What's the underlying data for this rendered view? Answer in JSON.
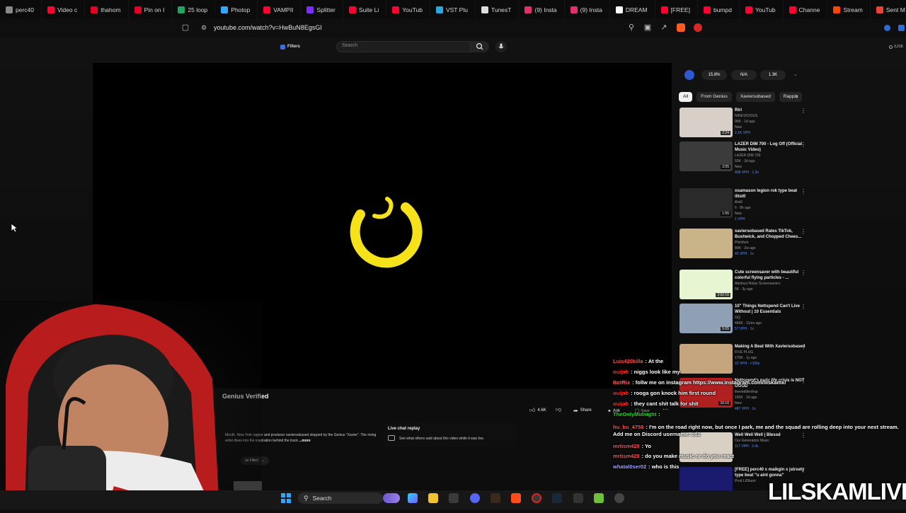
{
  "browser": {
    "tabs": [
      {
        "label": "perc40",
        "color": "#888888"
      },
      {
        "label": "Video c",
        "color": "#ff0033"
      },
      {
        "label": "thahom",
        "color": "#e60023"
      },
      {
        "label": "Pin on I",
        "color": "#e60023"
      },
      {
        "label": "25 loop",
        "color": "#1fa463"
      },
      {
        "label": "Photop",
        "color": "#31a8ff"
      },
      {
        "label": "VAMPII",
        "color": "#ff0033"
      },
      {
        "label": "Splitter",
        "color": "#7b2cff"
      },
      {
        "label": "Suite Li",
        "color": "#ff0033"
      },
      {
        "label": "YouTub",
        "color": "#ff0033"
      },
      {
        "label": "VST Plu",
        "color": "#2aa9e0"
      },
      {
        "label": "TunesT",
        "color": "#dddddd"
      },
      {
        "label": "(9) Insta",
        "color": "#e1306c"
      },
      {
        "label": "(9) Insta",
        "color": "#e1306c"
      },
      {
        "label": "DREAM",
        "color": "#ffffff"
      },
      {
        "label": "[FREE]",
        "color": "#ff0033"
      },
      {
        "label": "bumpd",
        "color": "#ff0033"
      },
      {
        "label": "YouTub",
        "color": "#ff0033"
      },
      {
        "label": "Channe",
        "color": "#ff0033"
      },
      {
        "label": "Stream",
        "color": "#ff4500"
      },
      {
        "label": "Sent M",
        "color": "#ea4335"
      }
    ],
    "url": "youtube.com/watch?v=HwBuN8EgsGI",
    "views_badge": "3,218"
  },
  "youtube": {
    "filters_label": "Filters",
    "search_placeholder": "Search",
    "channel_name": "Genius Verified",
    "description": "Month, New York rapper and producer xaviersobased stopped by the Genius \"Xavier\". The rising artist dives into the inspiration behind the track",
    "more_label": "...more",
    "likes": "4.6K",
    "share_label": "Share",
    "ask_label": "Ask",
    "save_label": "Save",
    "pill_label": "se Filter)",
    "live_chat": {
      "title": "Live chat replay",
      "subtitle": "See what others said about this video while it was live."
    },
    "stats": [
      "15.8%",
      "N/A",
      "1.3K"
    ],
    "chips": [
      "All",
      "From Genius",
      "Xaviersobased",
      "Rappin"
    ],
    "recommendations": [
      {
        "title": "Riri",
        "channel": "NINEVICIOUS",
        "stats": "95K · 1d ago",
        "tag": "New",
        "extra": "2.1K VPH",
        "duration": "2:24",
        "thumb": "#d9cfc9"
      },
      {
        "title": "LAZER DIM 700 - Log Off (Official Music Video)",
        "channel": "LAZER DIM 700",
        "stats": "55K · 3d ago",
        "tag": "New",
        "extra": "408 VPH · 1.3x",
        "duration": "2:05",
        "thumb": "#3b3b3b"
      },
      {
        "title": "osamason legion rok type beat illist0",
        "channel": "illist0",
        "stats": "6 · 8h ago",
        "tag": "New",
        "extra": "1 VPH",
        "duration": "1:55",
        "thumb": "#2a2a2a"
      },
      {
        "title": "xaviersobased Rates TikTok, Bushwick, and Chopped Chees...",
        "channel": "Pitchfork",
        "stats": "80K · 2w ago",
        "tag": "",
        "extra": "40 VPH · 1x",
        "duration": "",
        "thumb": "#c9b48a"
      },
      {
        "title": "Cute screensaver with beautiful colorful flying particles - ...",
        "channel": "Abstract Relax Screensavers",
        "stats": "5K · 3y ago",
        "tag": "",
        "extra": "",
        "duration": "2:02:16",
        "thumb": "#e8f5d2"
      },
      {
        "title": "10\" Things Nettspend Can't Live Without | 10 Essentials",
        "channel": "GQ",
        "stats": "466K · 11mo ago",
        "tag": "",
        "extra": "57 VPH · 1x",
        "duration": "5:05",
        "thumb": "#8fa0b5"
      },
      {
        "title": "Making A Beat With Xaviersobased",
        "channel": "FIVE PLUG",
        "stats": "170K · 1y ago",
        "tag": "",
        "extra": "22 VPH · >100x",
        "duration": "",
        "thumb": "#c4a57e"
      },
      {
        "title": "Nettspend's early life crisis is NOT GOOD",
        "channel": "theeeddieshop",
        "stats": "150K · 2d ago",
        "tag": "New",
        "extra": "487 VPH · 1x",
        "duration": "16:16",
        "thumb": "#b02020"
      },
      {
        "title": "Well Well Well | Blessd",
        "channel": "Our Generation Music",
        "stats": "",
        "tag": "",
        "extra": "117 VPH · 2.4x",
        "duration": "",
        "thumb": "#d9d0c4"
      },
      {
        "title": "[FREE] perc40 x maikgin x jstrxety type beat \"u aint gonna\"",
        "channel": "Prod LilSkam",
        "stats": "",
        "tag": "",
        "extra": "",
        "duration": "",
        "thumb": "#1a1a6e"
      }
    ]
  },
  "chat_overlay": [
    {
      "user": "Luis420killa",
      "text": ": At the",
      "color": "#ff4d4d"
    },
    {
      "user": "ouijah",
      "text": ": niggs look like my",
      "color": "#ff2d2d"
    },
    {
      "user": "BotRix",
      "text": ": follw me on instagram https://www.instagram.com/lilskamx/",
      "color": "#ff5a5a"
    },
    {
      "user": "ouijah",
      "text": ": rooga gon knock him first round",
      "color": "#ff2d2d"
    },
    {
      "user": "ouijah",
      "text": ": they cant shit talk for shit",
      "color": "#ff2d2d"
    },
    {
      "user": "TheOnlyMidnight",
      "text": ":",
      "color": "#2bd62b"
    },
    {
      "user": "hu_bu_4758",
      "text": ": I'm on the road right now, but once I park, me and the squad are rolling deep into your next stream. Add me on Discord username: ctl1",
      "color": "#ff4d4d"
    },
    {
      "user": "mrtism420",
      "text": ": Yo",
      "color": "#ff4d4d"
    },
    {
      "user": "mrtism420",
      "text": ": do you make music or do you react",
      "color": "#ff4d4d"
    },
    {
      "user": "whatal0ser02",
      "text": ": who is this",
      "color": "#a0a0ff"
    }
  ],
  "stream": {
    "watermark": "LILSKAMLIVE"
  },
  "taskbar": {
    "search_label": "Search"
  }
}
